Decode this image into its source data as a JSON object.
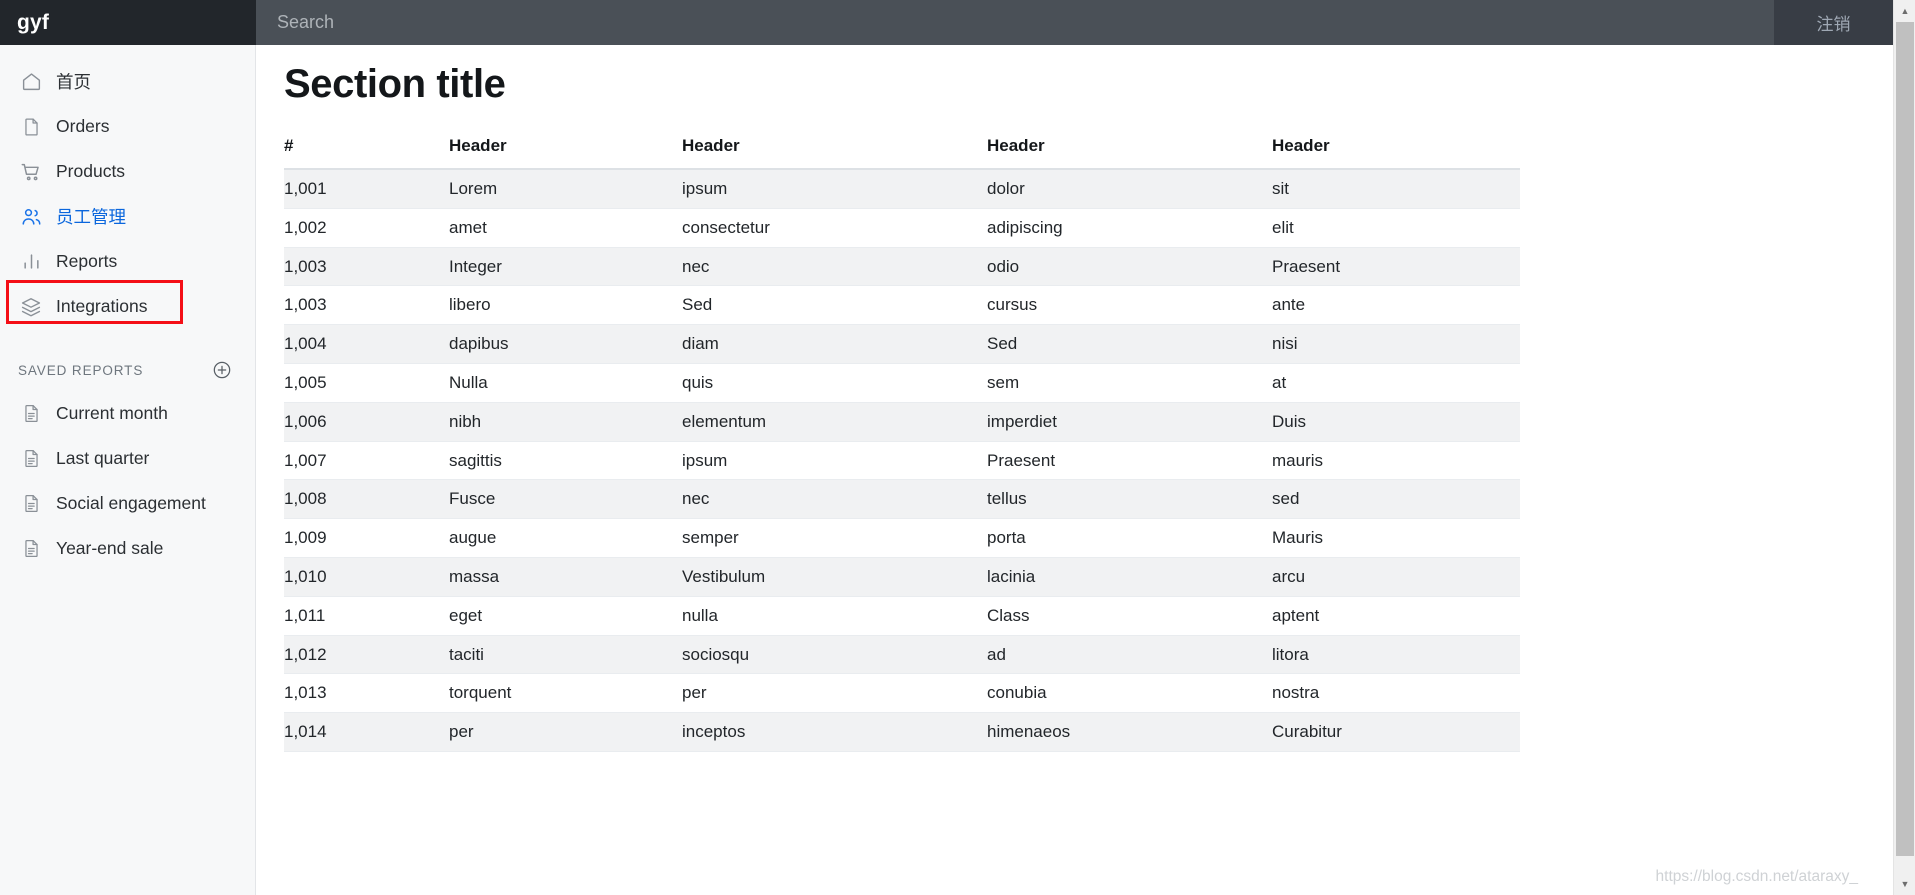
{
  "topbar": {
    "brand": "gyf",
    "search_placeholder": "Search",
    "search_value": "",
    "logout_label": "注销"
  },
  "sidebar": {
    "items": [
      {
        "label": "首页",
        "icon": "home-icon",
        "active": false
      },
      {
        "label": "Orders",
        "icon": "document-icon",
        "active": false
      },
      {
        "label": "Products",
        "icon": "shopping-cart-icon",
        "active": false
      },
      {
        "label": "员工管理",
        "icon": "users-icon",
        "active": true
      },
      {
        "label": "Reports",
        "icon": "bar-chart-icon",
        "active": false
      },
      {
        "label": "Integrations",
        "icon": "layers-icon",
        "active": false
      }
    ],
    "saved_reports": {
      "label": "SAVED REPORTS",
      "add_icon": "plus-circle-icon",
      "items": [
        {
          "label": "Current month",
          "icon": "file-text-icon"
        },
        {
          "label": "Last quarter",
          "icon": "file-text-icon"
        },
        {
          "label": "Social engagement",
          "icon": "file-text-icon"
        },
        {
          "label": "Year-end sale",
          "icon": "file-text-icon"
        }
      ]
    }
  },
  "main": {
    "title": "Section title",
    "table": {
      "headers": [
        "#",
        "Header",
        "Header",
        "Header",
        "Header"
      ],
      "rows": [
        [
          "1,001",
          "Lorem",
          "ipsum",
          "dolor",
          "sit"
        ],
        [
          "1,002",
          "amet",
          "consectetur",
          "adipiscing",
          "elit"
        ],
        [
          "1,003",
          "Integer",
          "nec",
          "odio",
          "Praesent"
        ],
        [
          "1,003",
          "libero",
          "Sed",
          "cursus",
          "ante"
        ],
        [
          "1,004",
          "dapibus",
          "diam",
          "Sed",
          "nisi"
        ],
        [
          "1,005",
          "Nulla",
          "quis",
          "sem",
          "at"
        ],
        [
          "1,006",
          "nibh",
          "elementum",
          "imperdiet",
          "Duis"
        ],
        [
          "1,007",
          "sagittis",
          "ipsum",
          "Praesent",
          "mauris"
        ],
        [
          "1,008",
          "Fusce",
          "nec",
          "tellus",
          "sed"
        ],
        [
          "1,009",
          "augue",
          "semper",
          "porta",
          "Mauris"
        ],
        [
          "1,010",
          "massa",
          "Vestibulum",
          "lacinia",
          "arcu"
        ],
        [
          "1,011",
          "eget",
          "nulla",
          "Class",
          "aptent"
        ],
        [
          "1,012",
          "taciti",
          "sociosqu",
          "ad",
          "litora"
        ],
        [
          "1,013",
          "torquent",
          "per",
          "conubia",
          "nostra"
        ],
        [
          "1,014",
          "per",
          "inceptos",
          "himenaeos",
          "Curabitur"
        ]
      ]
    }
  },
  "annotation": {
    "target": "员工管理",
    "color": "#f40f17"
  },
  "watermark": "https://blog.csdn.net/ataraxy_",
  "colors": {
    "brand_bg": "#22262b",
    "topbar_bg": "#4a5057",
    "logout_bg": "#383d45",
    "sidebar_bg": "#f7f8f9",
    "active_link": "#0a66dd",
    "annotation": "#f40f17",
    "row_stripe": "#f1f2f3"
  }
}
